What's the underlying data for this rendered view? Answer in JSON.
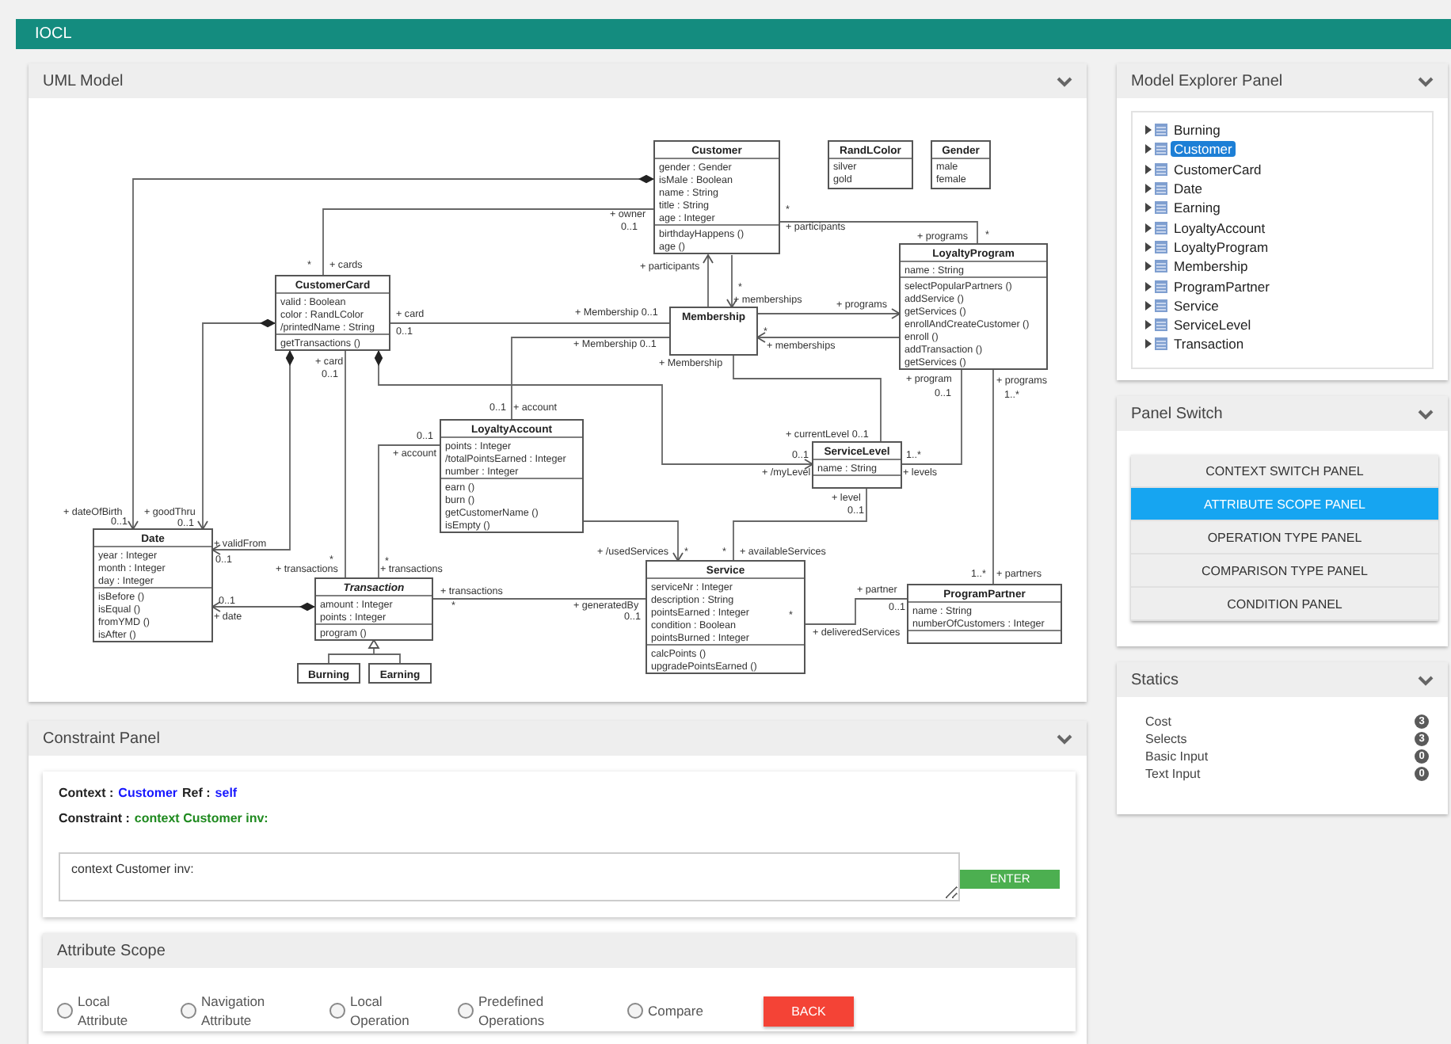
{
  "app_bar": {
    "title": "IOCL"
  },
  "uml_model": {
    "title": "UML Model",
    "classes": [
      {
        "name": "Customer",
        "kind": "class",
        "abstract": false,
        "attributes": [
          "gender : Gender",
          "isMale : Boolean",
          "name : String",
          "title : String",
          "age : Integer"
        ],
        "operations": [
          "birthdayHappens ()",
          "age ()"
        ]
      },
      {
        "name": "RandLColor",
        "kind": "enumeration",
        "abstract": false,
        "literals": [
          "silver",
          "gold"
        ]
      },
      {
        "name": "Gender",
        "kind": "enumeration",
        "abstract": false,
        "literals": [
          "male",
          "female"
        ]
      },
      {
        "name": "LoyaltyProgram",
        "kind": "class",
        "abstract": false,
        "attributes": [
          "name : String"
        ],
        "operations": [
          "selectPopularPartners ()",
          "addService ()",
          "getServices ()",
          "enrollAndCreateCustomer ()",
          "enroll ()",
          "addTransaction ()",
          "getServices ()"
        ]
      },
      {
        "name": "Membership",
        "kind": "class",
        "abstract": false
      },
      {
        "name": "CustomerCard",
        "kind": "class",
        "abstract": false,
        "attributes": [
          "valid : Boolean",
          "color : RandLColor",
          "/printedName : String"
        ],
        "operations": [
          "getTransactions ()"
        ]
      },
      {
        "name": "LoyaltyAccount",
        "kind": "class",
        "abstract": false,
        "attributes": [
          "points : Integer",
          "/totalPointsEarned : Integer",
          "number : Integer"
        ],
        "operations": [
          "earn ()",
          "burn ()",
          "getCustomerName ()",
          "isEmpty ()"
        ]
      },
      {
        "name": "ServiceLevel",
        "kind": "class",
        "abstract": false,
        "attributes": [
          "name : String"
        ]
      },
      {
        "name": "Date",
        "kind": "class",
        "abstract": false,
        "attributes": [
          "year : Integer",
          "month : Integer",
          "day : Integer"
        ],
        "operations": [
          "isBefore ()",
          "isEqual ()",
          "fromYMD ()",
          "isAfter ()"
        ]
      },
      {
        "name": "Transaction",
        "kind": "class",
        "abstract": true,
        "attributes": [
          "amount : Integer",
          "points : Integer"
        ],
        "operations": [
          "program ()"
        ]
      },
      {
        "name": "Service",
        "kind": "class",
        "abstract": false,
        "attributes": [
          "serviceNr : Integer",
          "description : String",
          "pointsEarned : Integer",
          "condition : Boolean",
          "pointsBurned : Integer"
        ],
        "operations": [
          "calcPoints ()",
          "upgradePointsEarned ()"
        ]
      },
      {
        "name": "ProgramPartner",
        "kind": "class",
        "abstract": false,
        "attributes": [
          "name : String",
          "numberOfCustomers : Integer"
        ]
      },
      {
        "name": "Burning",
        "kind": "name_only",
        "abstract": false
      },
      {
        "name": "Earning",
        "kind": "name_only",
        "abstract": false
      }
    ],
    "associations": [
      {
        "labels": [
          "+ dateOfBirth",
          "0..1"
        ]
      },
      {
        "labels": [
          "+ owner",
          "0..1",
          "*",
          "+ cards"
        ]
      },
      {
        "labels": [
          "*",
          "+ participants",
          "+ programs",
          "*"
        ]
      },
      {
        "labels": [
          "+ participants"
        ]
      },
      {
        "labels": [
          "*",
          "+ memberships"
        ]
      },
      {
        "labels": [
          "+ programs"
        ]
      },
      {
        "labels": [
          "+ goodThru",
          "0..1"
        ]
      },
      {
        "labels": [
          "+ card",
          "0..1",
          "+ Membership 0..1"
        ]
      },
      {
        "labels": [
          "+ Membership 0..1",
          "0..1",
          "+ account"
        ]
      },
      {
        "labels": [
          "*",
          "+ memberships"
        ]
      },
      {
        "labels": [
          "+ validFrom",
          "0..1"
        ]
      },
      {
        "labels": [
          "+ card",
          "0..1",
          "*",
          "+ transactions"
        ]
      },
      {
        "labels": [
          "+ Membership",
          "+ currentLevel 0..1"
        ]
      },
      {
        "labels": [
          "0..1",
          "+ /myLevel"
        ]
      },
      {
        "labels": [
          "+ program",
          "0..1",
          "1..*",
          "+ levels"
        ]
      },
      {
        "labels": [
          "+ programs",
          "1..*",
          "1..*",
          "+ partners"
        ]
      },
      {
        "labels": [
          "0..1",
          "+ account",
          "*",
          "+ transactions"
        ]
      },
      {
        "labels": [
          "+ /usedServices",
          "*"
        ]
      },
      {
        "labels": [
          "+ level",
          "0..1",
          "*",
          "+ availableServices"
        ]
      },
      {
        "labels": [
          "0..1",
          "+ date"
        ]
      },
      {
        "labels": [
          "+ transactions",
          "*",
          "+ generatedBy",
          "0..1"
        ]
      },
      {
        "labels": [
          "+ partner",
          "0..1",
          "*",
          "+ deliveredServices"
        ]
      }
    ]
  },
  "constraint_panel": {
    "title": "Constraint Panel",
    "context": {
      "label": "Context :",
      "class": "Customer",
      "ref_label": "Ref :",
      "ref": "self"
    },
    "constraint": {
      "label": "Constraint :",
      "value": "context Customer inv:"
    },
    "input": {
      "value": "context Customer inv:"
    },
    "enter_button": "ENTER",
    "attribute_scope": {
      "title": "Attribute Scope",
      "options": [
        {
          "label": "Local Attribute",
          "selected": false
        },
        {
          "label": "Navigation Attribute",
          "selected": false
        },
        {
          "label": "Local Operation",
          "selected": false
        },
        {
          "label": "Predefined Operations",
          "selected": false
        },
        {
          "label": "Compare",
          "selected": false
        }
      ],
      "back_button": "BACK"
    }
  },
  "model_explorer": {
    "title": "Model Explorer Panel",
    "items": [
      {
        "label": "Burning",
        "selected": false
      },
      {
        "label": "Customer",
        "selected": true
      },
      {
        "label": "CustomerCard",
        "selected": false
      },
      {
        "label": "Date",
        "selected": false
      },
      {
        "label": "Earning",
        "selected": false
      },
      {
        "label": "LoyaltyAccount",
        "selected": false
      },
      {
        "label": "LoyaltyProgram",
        "selected": false
      },
      {
        "label": "Membership",
        "selected": false
      },
      {
        "label": "ProgramPartner",
        "selected": false
      },
      {
        "label": "Service",
        "selected": false
      },
      {
        "label": "ServiceLevel",
        "selected": false
      },
      {
        "label": "Transaction",
        "selected": false
      }
    ]
  },
  "panel_switch": {
    "title": "Panel Switch",
    "items": [
      {
        "label": "CONTEXT SWITCH PANEL",
        "selected": false
      },
      {
        "label": "ATTRIBUTE SCOPE PANEL",
        "selected": true
      },
      {
        "label": "OPERATION TYPE PANEL",
        "selected": false
      },
      {
        "label": "COMPARISON TYPE PANEL",
        "selected": false
      },
      {
        "label": "CONDITION PANEL",
        "selected": false
      }
    ]
  },
  "statics": {
    "title": "Statics",
    "items": [
      {
        "label": "Cost",
        "count": "3"
      },
      {
        "label": "Selects",
        "count": "3"
      },
      {
        "label": "Basic Input",
        "count": "0"
      },
      {
        "label": "Text Input",
        "count": "0"
      }
    ]
  }
}
